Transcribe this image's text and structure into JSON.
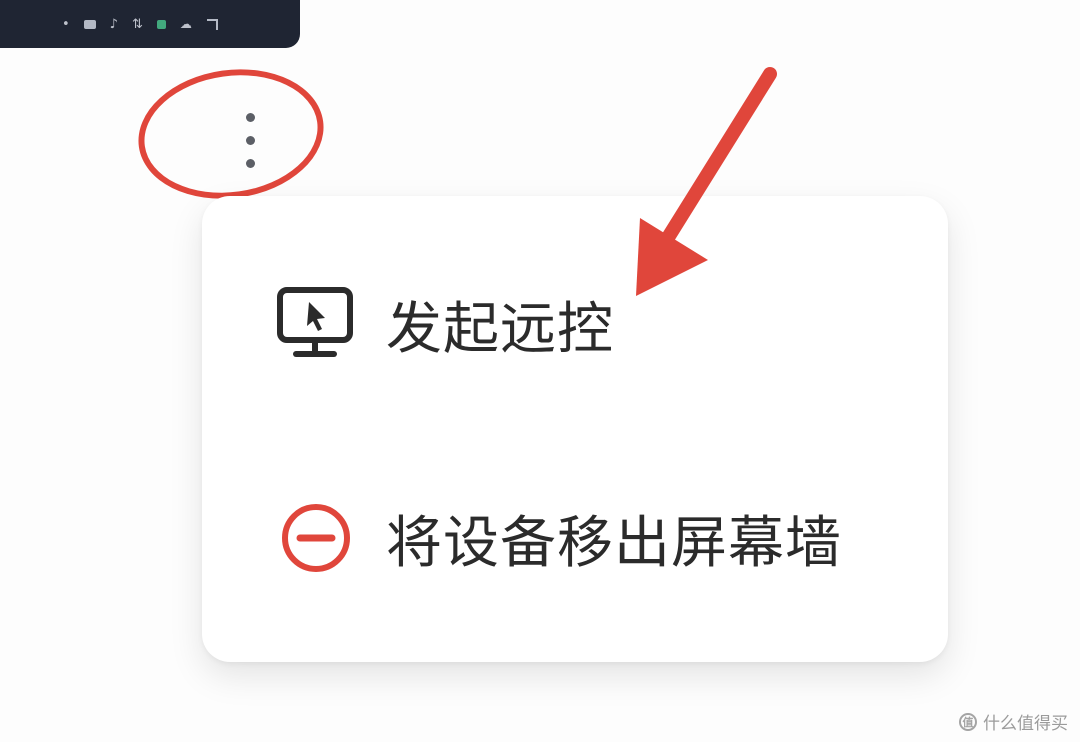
{
  "status_bar": {
    "items": [
      "status-dot-icon",
      "display-icon",
      "sound-icon",
      "network-icon",
      "active-app-icon",
      "cloud-icon",
      "window-icon"
    ],
    "accent_green": "#49c18c"
  },
  "kebab": {
    "icon": "more-vertical-icon"
  },
  "menu": {
    "items": [
      {
        "label": "发起远控",
        "icon": "monitor-cursor-icon",
        "icon_color": "#2b2b2b"
      },
      {
        "label": "将设备移出屏幕墙",
        "icon": "remove-circle-icon",
        "icon_color": "#e0463b"
      }
    ]
  },
  "annotation": {
    "color": "#e0463b"
  },
  "watermark": {
    "text": "什么值得买",
    "logo_glyph": "值"
  }
}
